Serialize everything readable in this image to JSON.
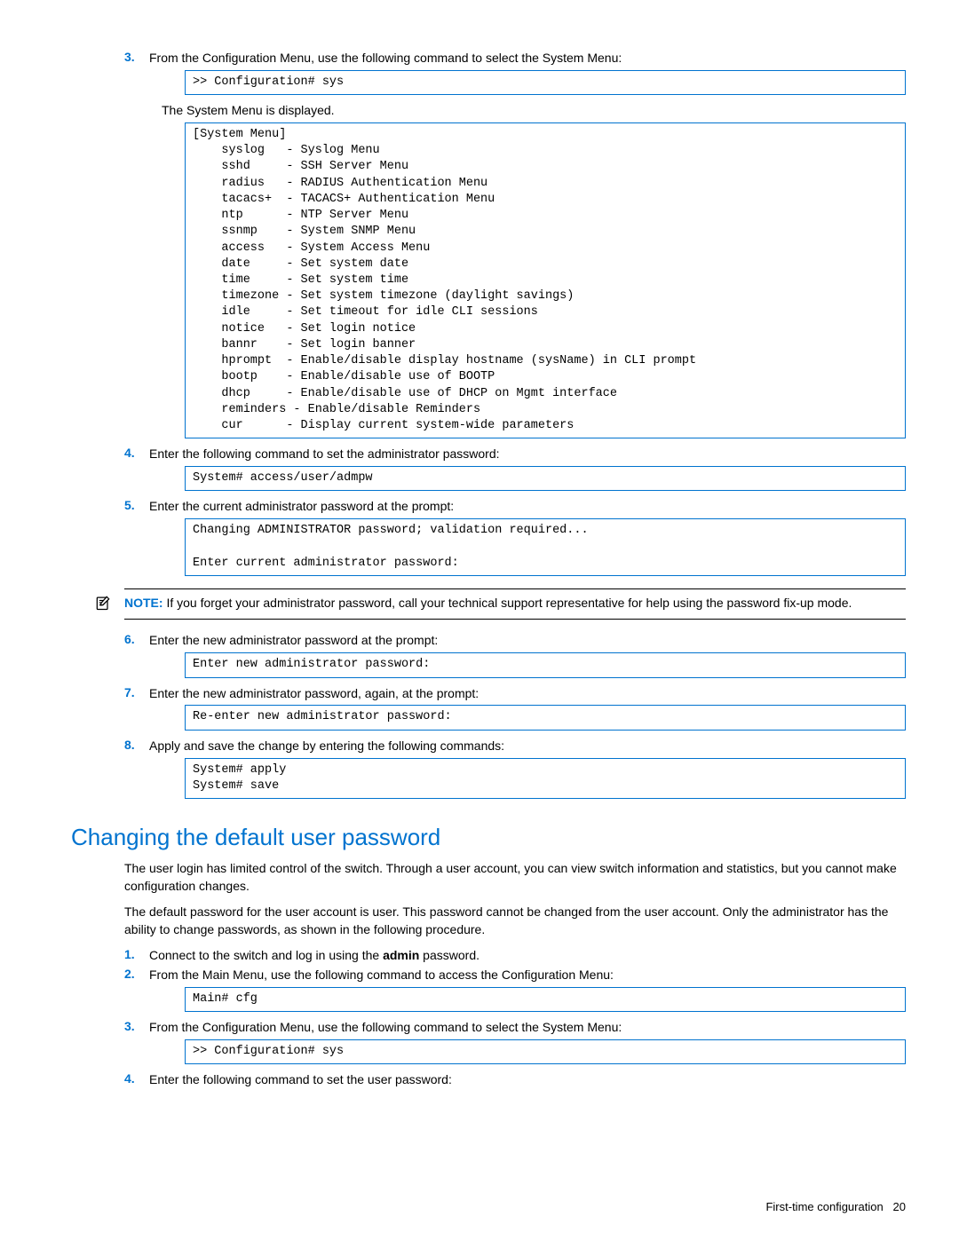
{
  "steps1": {
    "s3num": "3.",
    "s3text": "From the Configuration Menu, use the following command to select the System Menu:",
    "s3code": ">> Configuration# sys",
    "s3after": "The System Menu is displayed.",
    "s3code2": "[System Menu]\n    syslog   - Syslog Menu\n    sshd     - SSH Server Menu\n    radius   - RADIUS Authentication Menu\n    tacacs+  - TACACS+ Authentication Menu\n    ntp      - NTP Server Menu\n    ssnmp    - System SNMP Menu\n    access   - System Access Menu\n    date     - Set system date\n    time     - Set system time\n    timezone - Set system timezone (daylight savings)\n    idle     - Set timeout for idle CLI sessions\n    notice   - Set login notice\n    bannr    - Set login banner\n    hprompt  - Enable/disable display hostname (sysName) in CLI prompt\n    bootp    - Enable/disable use of BOOTP\n    dhcp     - Enable/disable use of DHCP on Mgmt interface\n    reminders - Enable/disable Reminders\n    cur      - Display current system-wide parameters",
    "s4num": "4.",
    "s4text": "Enter the following command to set the administrator password:",
    "s4code": "System# access/user/admpw",
    "s5num": "5.",
    "s5text": "Enter the current administrator password at the prompt:",
    "s5code": "Changing ADMINISTRATOR password; validation required...\n\nEnter current administrator password:",
    "note_label": "NOTE:",
    "note_text": " If you forget your administrator password, call your technical support representative for help using the password fix-up mode.",
    "s6num": "6.",
    "s6text": "Enter the new administrator password at the prompt:",
    "s6code": "Enter new administrator password:",
    "s7num": "7.",
    "s7text": "Enter the new administrator password, again, at the prompt:",
    "s7code": "Re-enter new administrator password:",
    "s8num": "8.",
    "s8text": "Apply and save the change by entering the following commands:",
    "s8code": "System# apply\nSystem# save"
  },
  "heading2": "Changing the default user password",
  "para1": "The user login has limited control of the switch. Through a user account, you can view switch information and statistics, but you cannot make configuration changes.",
  "para2": "The default password for the user account is user. This password cannot be changed from the user account. Only the administrator has the ability to change passwords, as shown in the following procedure.",
  "steps2": {
    "s1num": "1.",
    "s1text_a": "Connect to the switch and log in using the ",
    "s1text_bold": "admin",
    "s1text_b": " password.",
    "s2num": "2.",
    "s2text": "From the Main Menu, use the following command to access the Configuration Menu:",
    "s2code": "Main# cfg",
    "s3num": "3.",
    "s3text": "From the Configuration Menu, use the following command to select the System Menu:",
    "s3code": ">> Configuration# sys",
    "s4num": "4.",
    "s4text": "Enter the following command to set the user password:"
  },
  "footer": {
    "section": "First-time configuration",
    "page": "20"
  }
}
